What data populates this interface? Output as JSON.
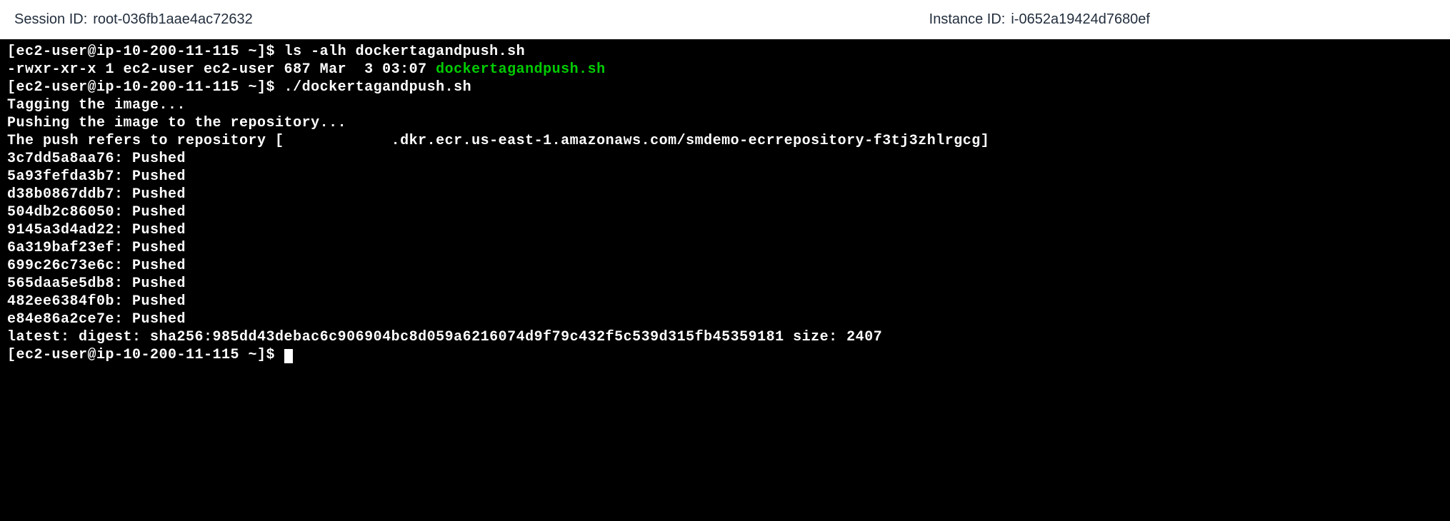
{
  "header": {
    "session_id_label": "Session ID:",
    "session_id_value": "root-036fb1aae4ac72632",
    "instance_id_label": "Instance ID:",
    "instance_id_value": "i-0652a19424d7680ef"
  },
  "terminal": {
    "prompt": "[ec2-user@ip-10-200-11-115 ~]$ ",
    "cmd1": "ls -alh dockertagandpush.sh",
    "ls_output_prefix": "-rwxr-xr-x 1 ec2-user ec2-user 687 Mar  3 03:07 ",
    "ls_output_file": "dockertagandpush.sh",
    "cmd2": "./dockertagandpush.sh",
    "lines": [
      "Tagging the image...",
      "Pushing the image to the repository...",
      "The push refers to repository [            .dkr.ecr.us-east-1.amazonaws.com/smdemo-ecrrepository-f3tj3zhlrgcg]",
      "3c7dd5a8aa76: Pushed",
      "5a93fefda3b7: Pushed",
      "d38b0867ddb7: Pushed",
      "504db2c86050: Pushed",
      "9145a3d4ad22: Pushed",
      "6a319baf23ef: Pushed",
      "699c26c73e6c: Pushed",
      "565daa5e5db8: Pushed",
      "482ee6384f0b: Pushed",
      "e84e86a2ce7e: Pushed",
      "latest: digest: sha256:985dd43debac6c906904bc8d059a6216074d9f79c432f5c539d315fb45359181 size: 2407"
    ]
  }
}
